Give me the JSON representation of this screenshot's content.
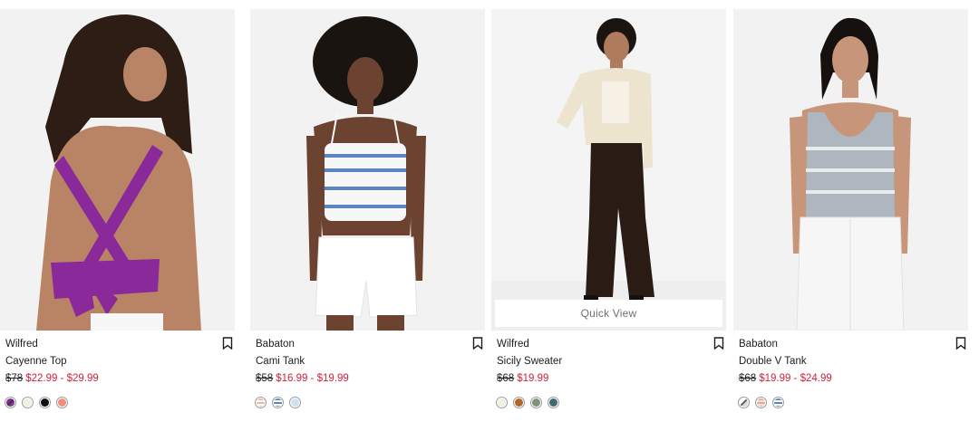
{
  "products": [
    {
      "brand": "Babaton",
      "name": "Cami Tank",
      "was_price": "$58",
      "sale_price": "$16.99 - $19.99",
      "swatches": [
        "stripe-peach",
        "stripe-blue",
        "light-blue"
      ],
      "quick_view": ""
    },
    {
      "brand": "Wilfred",
      "name": "Sicily Sweater",
      "was_price": "$68",
      "sale_price": "$19.99",
      "swatches": [
        "cream",
        "rust",
        "sage",
        "teal"
      ],
      "quick_view": "Quick View"
    },
    {
      "brand": "Babaton",
      "name": "Double V Tank",
      "was_price": "$68",
      "sale_price": "$19.99 - $24.99",
      "swatches": [
        "stripe-grey",
        "stripe-peach",
        "stripe-blue"
      ],
      "quick_view": ""
    },
    {
      "brand": "Wilfred",
      "name": "Cayenne Top",
      "was_price": "$78",
      "sale_price": "$22.99 - $29.99",
      "swatches": [
        "purple",
        "ivory",
        "black",
        "salmon"
      ],
      "quick_view": ""
    }
  ],
  "colors": {
    "sale": "#d0223a",
    "purple": "#8a2a9a",
    "stripe_blue": "#5a86c0"
  },
  "icons": {
    "bookmark": "bookmark-icon"
  }
}
